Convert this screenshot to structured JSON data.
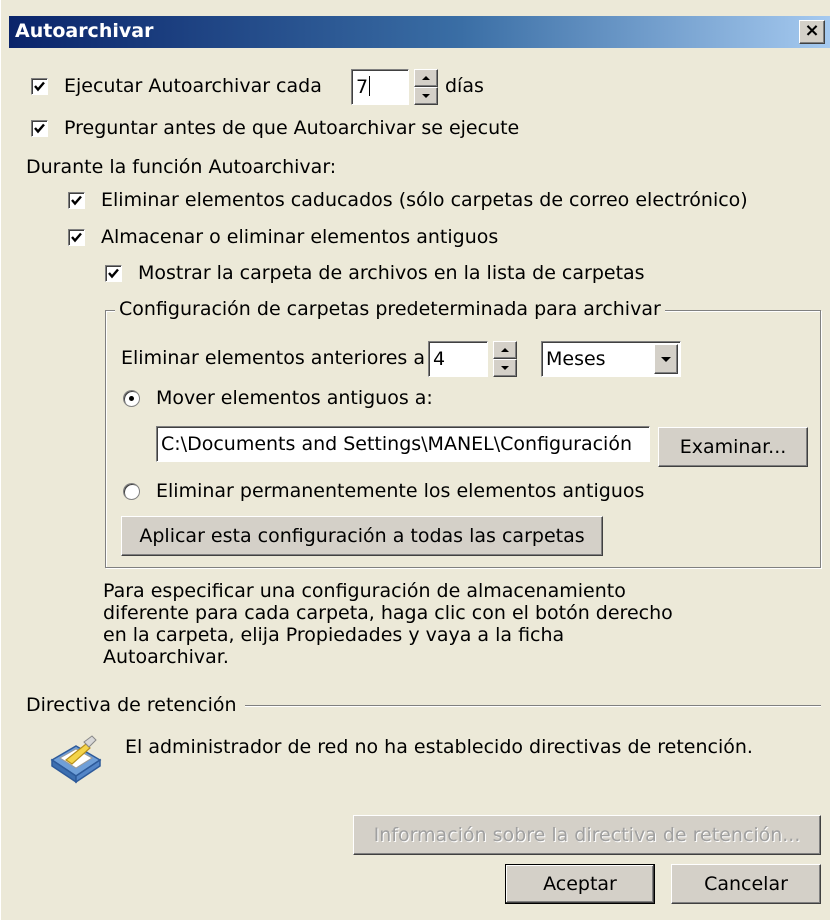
{
  "window": {
    "title": "Autoarchivar",
    "close_glyph": "×"
  },
  "run": {
    "label_prefix": "Ejecutar Autoarchivar cada",
    "days_value": "7",
    "label_suffix": "días",
    "checked": true
  },
  "prompt": {
    "label": "Preguntar antes de que Autoarchivar se ejecute",
    "checked": true
  },
  "during": {
    "label": "Durante la función Autoarchivar:",
    "delete_expired": {
      "label": "Eliminar elementos caducados (sólo carpetas de correo electrónico)",
      "checked": true
    },
    "archive_old": {
      "label": "Almacenar o eliminar elementos antiguos",
      "checked": true
    },
    "show_folder": {
      "label": "Mostrar la carpeta de archivos en la lista de carpetas",
      "checked": true
    }
  },
  "defaults": {
    "legend": "Configuración de carpetas predeterminada para archivar",
    "older_label": "Eliminar elementos anteriores a",
    "older_value": "4",
    "unit_value": "Meses",
    "move": {
      "label": "Mover elementos antiguos a:",
      "selected": true,
      "path": "C:\\Documents and Settings\\MANEL\\Configuración",
      "browse_label": "Examinar..."
    },
    "delete_permanent": {
      "label": "Eliminar permanentemente los elementos antiguos",
      "selected": false
    },
    "apply_all_label": "Aplicar esta configuración a todas las carpetas"
  },
  "note": {
    "lines": [
      "Para especificar una configuración de almacenamiento",
      "diferente para cada carpeta, haga clic con el botón derecho",
      "en la carpeta, elija Propiedades y vaya a la ficha",
      "Autoarchivar."
    ]
  },
  "retention": {
    "legend": "Directiva de retención",
    "message": "El administrador de red no ha establecido directivas de retención.",
    "icon": "retention-policy-icon",
    "info_button_label": "Información sobre la directiva de retención..."
  },
  "footer": {
    "ok_label": "Aceptar",
    "cancel_label": "Cancelar"
  }
}
